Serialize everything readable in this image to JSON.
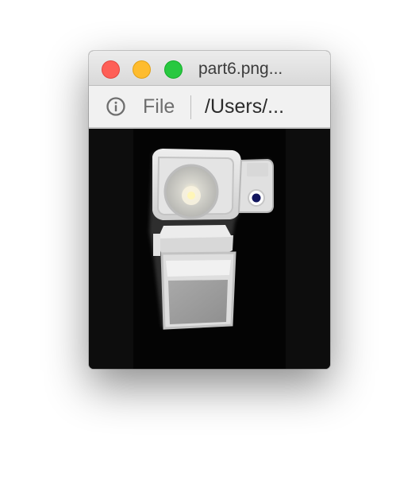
{
  "window": {
    "title": "part6.png...",
    "controls": {
      "close": "close",
      "minimize": "minimize",
      "zoom": "zoom"
    }
  },
  "toolbar": {
    "info_icon": "info-icon",
    "file_label": "File",
    "path_label": "/Users/..."
  },
  "image": {
    "description_icon": "camera-module-photo",
    "background_color": "#0c0c0c"
  },
  "colors": {
    "close": "#fe5f57",
    "minimize": "#febc2e",
    "zoom": "#28c840"
  }
}
